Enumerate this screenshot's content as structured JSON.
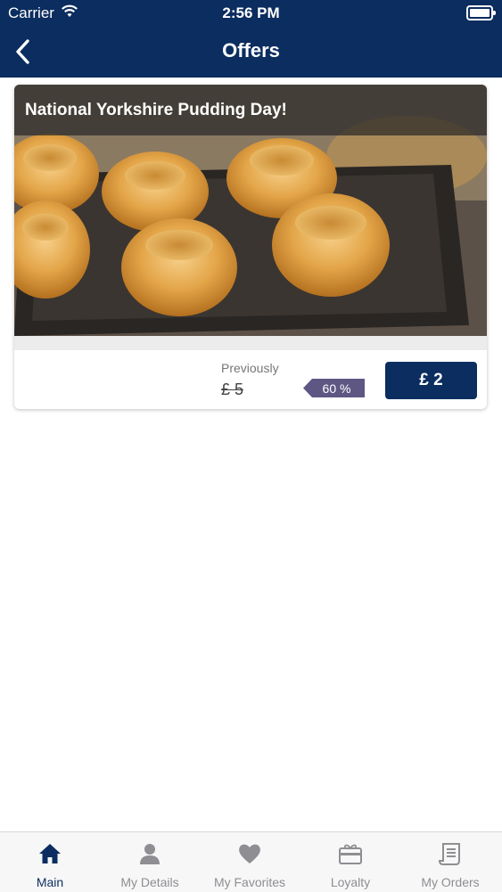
{
  "status_bar": {
    "carrier": "Carrier",
    "time": "2:56 PM"
  },
  "nav": {
    "title": "Offers"
  },
  "offer": {
    "title": "National Yorkshire Pudding Day!",
    "previously_label": "Previously",
    "old_price": "£ 5",
    "discount": "60 %",
    "price": "£ 2"
  },
  "tabs": [
    {
      "label": "Main",
      "icon": "home-icon",
      "active": true
    },
    {
      "label": "My Details",
      "icon": "person-icon",
      "active": false
    },
    {
      "label": "My Favorites",
      "icon": "heart-icon",
      "active": false
    },
    {
      "label": "Loyalty",
      "icon": "gift-card-icon",
      "active": false
    },
    {
      "label": "My Orders",
      "icon": "receipt-icon",
      "active": false
    }
  ],
  "colors": {
    "brand": "#0b2d5f",
    "discount": "#5e5784",
    "tab_inactive": "#8e8e93"
  }
}
